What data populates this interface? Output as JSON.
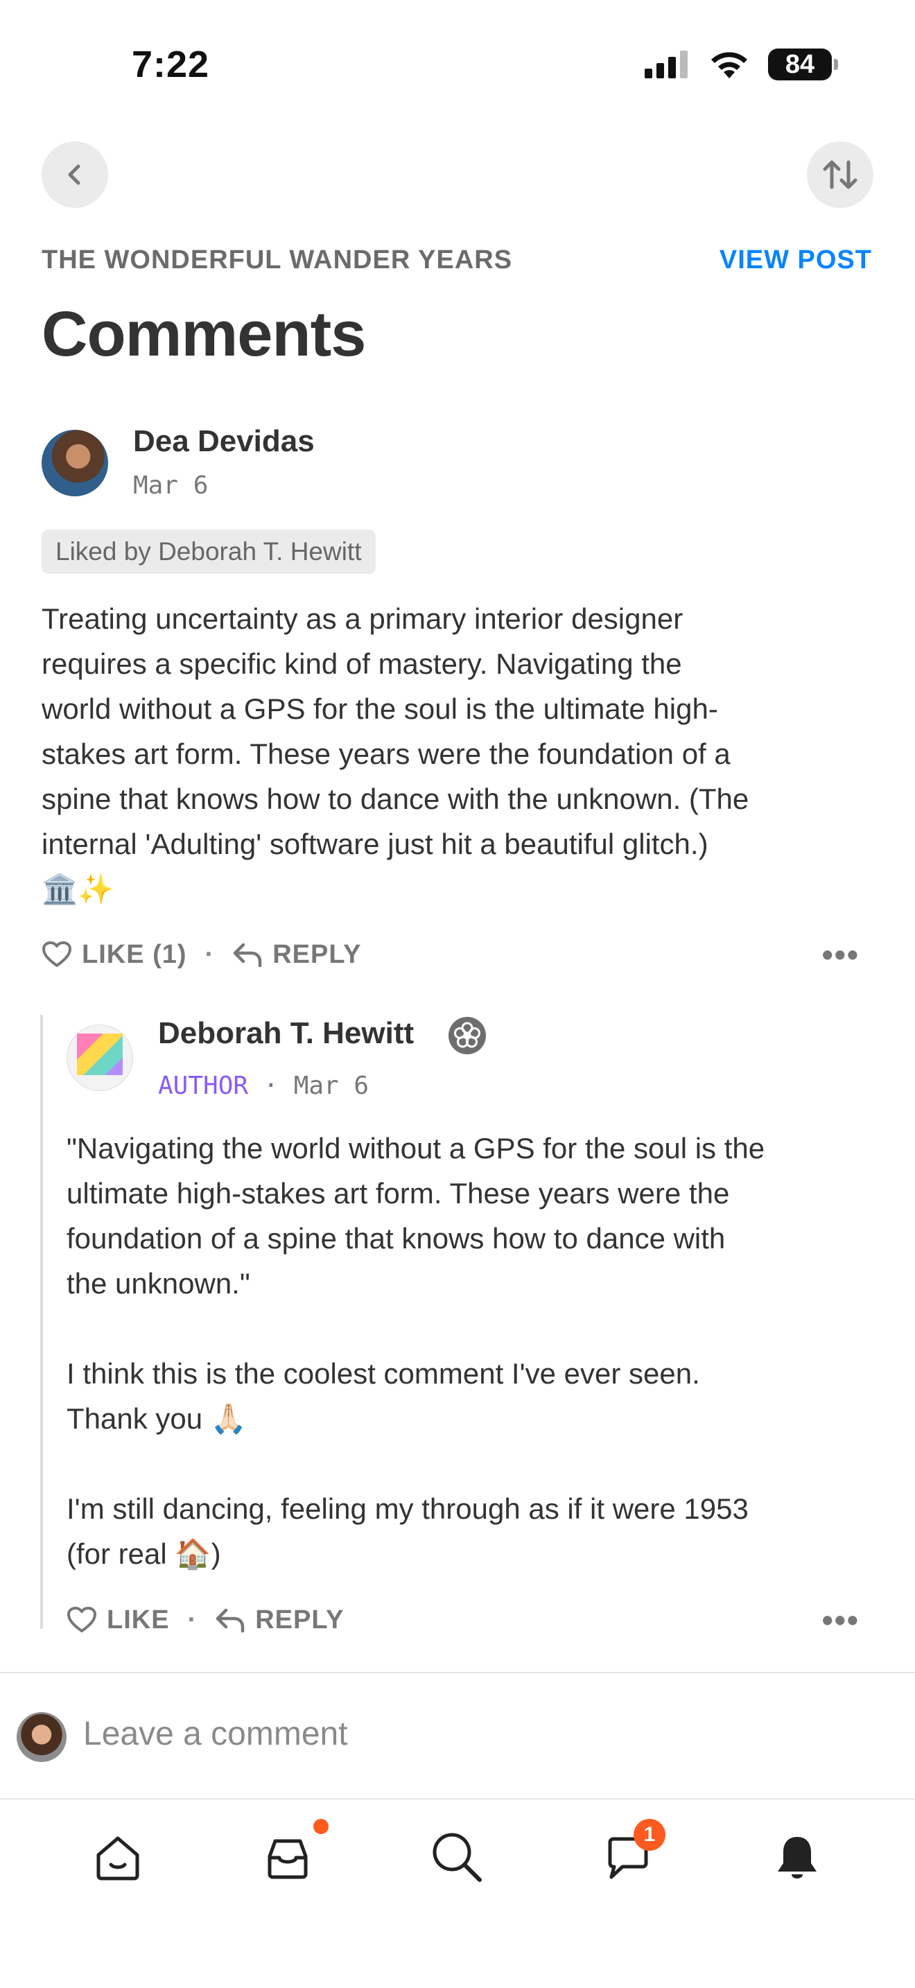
{
  "status_bar": {
    "time": "7:22",
    "battery": "84"
  },
  "header": {
    "publication": "THE WONDERFUL WANDER YEARS",
    "view_post": "VIEW POST",
    "title": "Comments"
  },
  "comments": [
    {
      "author": "Dea Devidas",
      "date": "Mar 6",
      "liked_by": "Liked by Deborah T. Hewitt",
      "body_lines": [
        "Treating uncertainty as a primary interior designer",
        "requires a specific kind of mastery. Navigating the",
        "world without a GPS for the soul is the ultimate high-",
        "stakes art form. These years were the foundation of a",
        "spine that knows how to dance with the unknown. (The",
        "internal 'Adulting' software just hit a beautiful glitch.)",
        "🏛️✨"
      ],
      "like_label": "LIKE (1)",
      "reply_label": "REPLY",
      "more": "•••"
    }
  ],
  "reply": {
    "author": "Deborah T. Hewitt",
    "role": "AUTHOR",
    "separator": "·",
    "date": "Mar 6",
    "body_lines": [
      "\"Navigating the world without a GPS for the soul is the",
      "ultimate high-stakes art form. These years were the",
      "foundation of a spine that knows how to dance with",
      "the unknown.\"",
      "",
      "I think this is the coolest comment I've ever seen.",
      "Thank you 🙏🏻",
      "",
      "I'm still dancing, feeling my through as if it were 1953",
      "(for real 🏠)"
    ],
    "like_label": "LIKE",
    "reply_label": "REPLY",
    "more": "•••"
  },
  "action_separator": "·",
  "composer": {
    "placeholder": "Leave a comment"
  },
  "bottom_nav": {
    "items": [
      "home",
      "inbox",
      "search",
      "chat",
      "notifications"
    ],
    "chat_badge": "1"
  },
  "colors": {
    "accent_blue": "#0a84ff",
    "author_purple": "#8a5cf6",
    "badge_orange": "#ff5a1f",
    "text": "#333333",
    "muted": "#777777"
  }
}
